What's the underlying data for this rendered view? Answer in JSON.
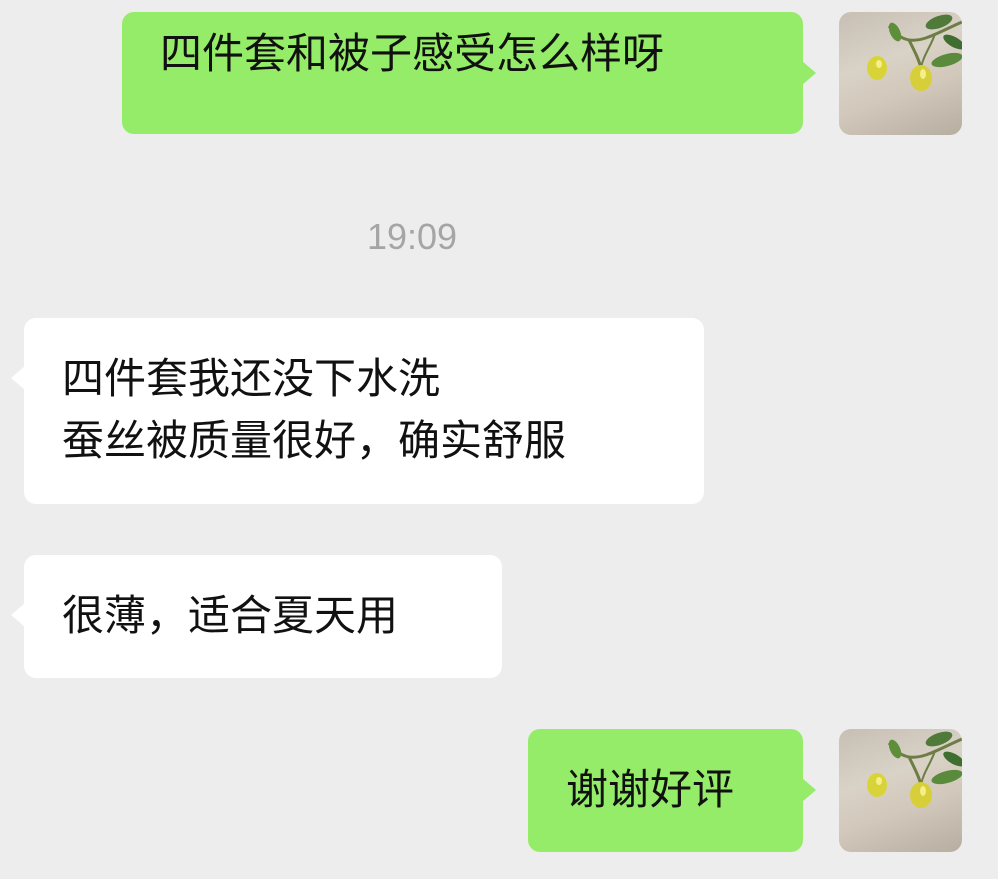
{
  "chat": {
    "timestamp": "19:09",
    "messages": [
      {
        "direction": "outgoing",
        "lines": [
          "四件套和被子感受怎么样呀"
        ]
      },
      {
        "direction": "incoming",
        "lines": [
          "四件套我还没下水洗",
          "蚕丝被质量很好，确实舒服"
        ]
      },
      {
        "direction": "incoming",
        "lines": [
          "很薄，适合夏天用"
        ]
      },
      {
        "direction": "outgoing",
        "lines": [
          "谢谢好评"
        ]
      }
    ]
  },
  "avatar": {
    "icon": "lemon-plant-photo-icon"
  },
  "colors": {
    "background": "#ededed",
    "outgoing_bubble": "#95ec69",
    "incoming_bubble": "#ffffff",
    "timestamp_text": "#a5a5a5"
  }
}
